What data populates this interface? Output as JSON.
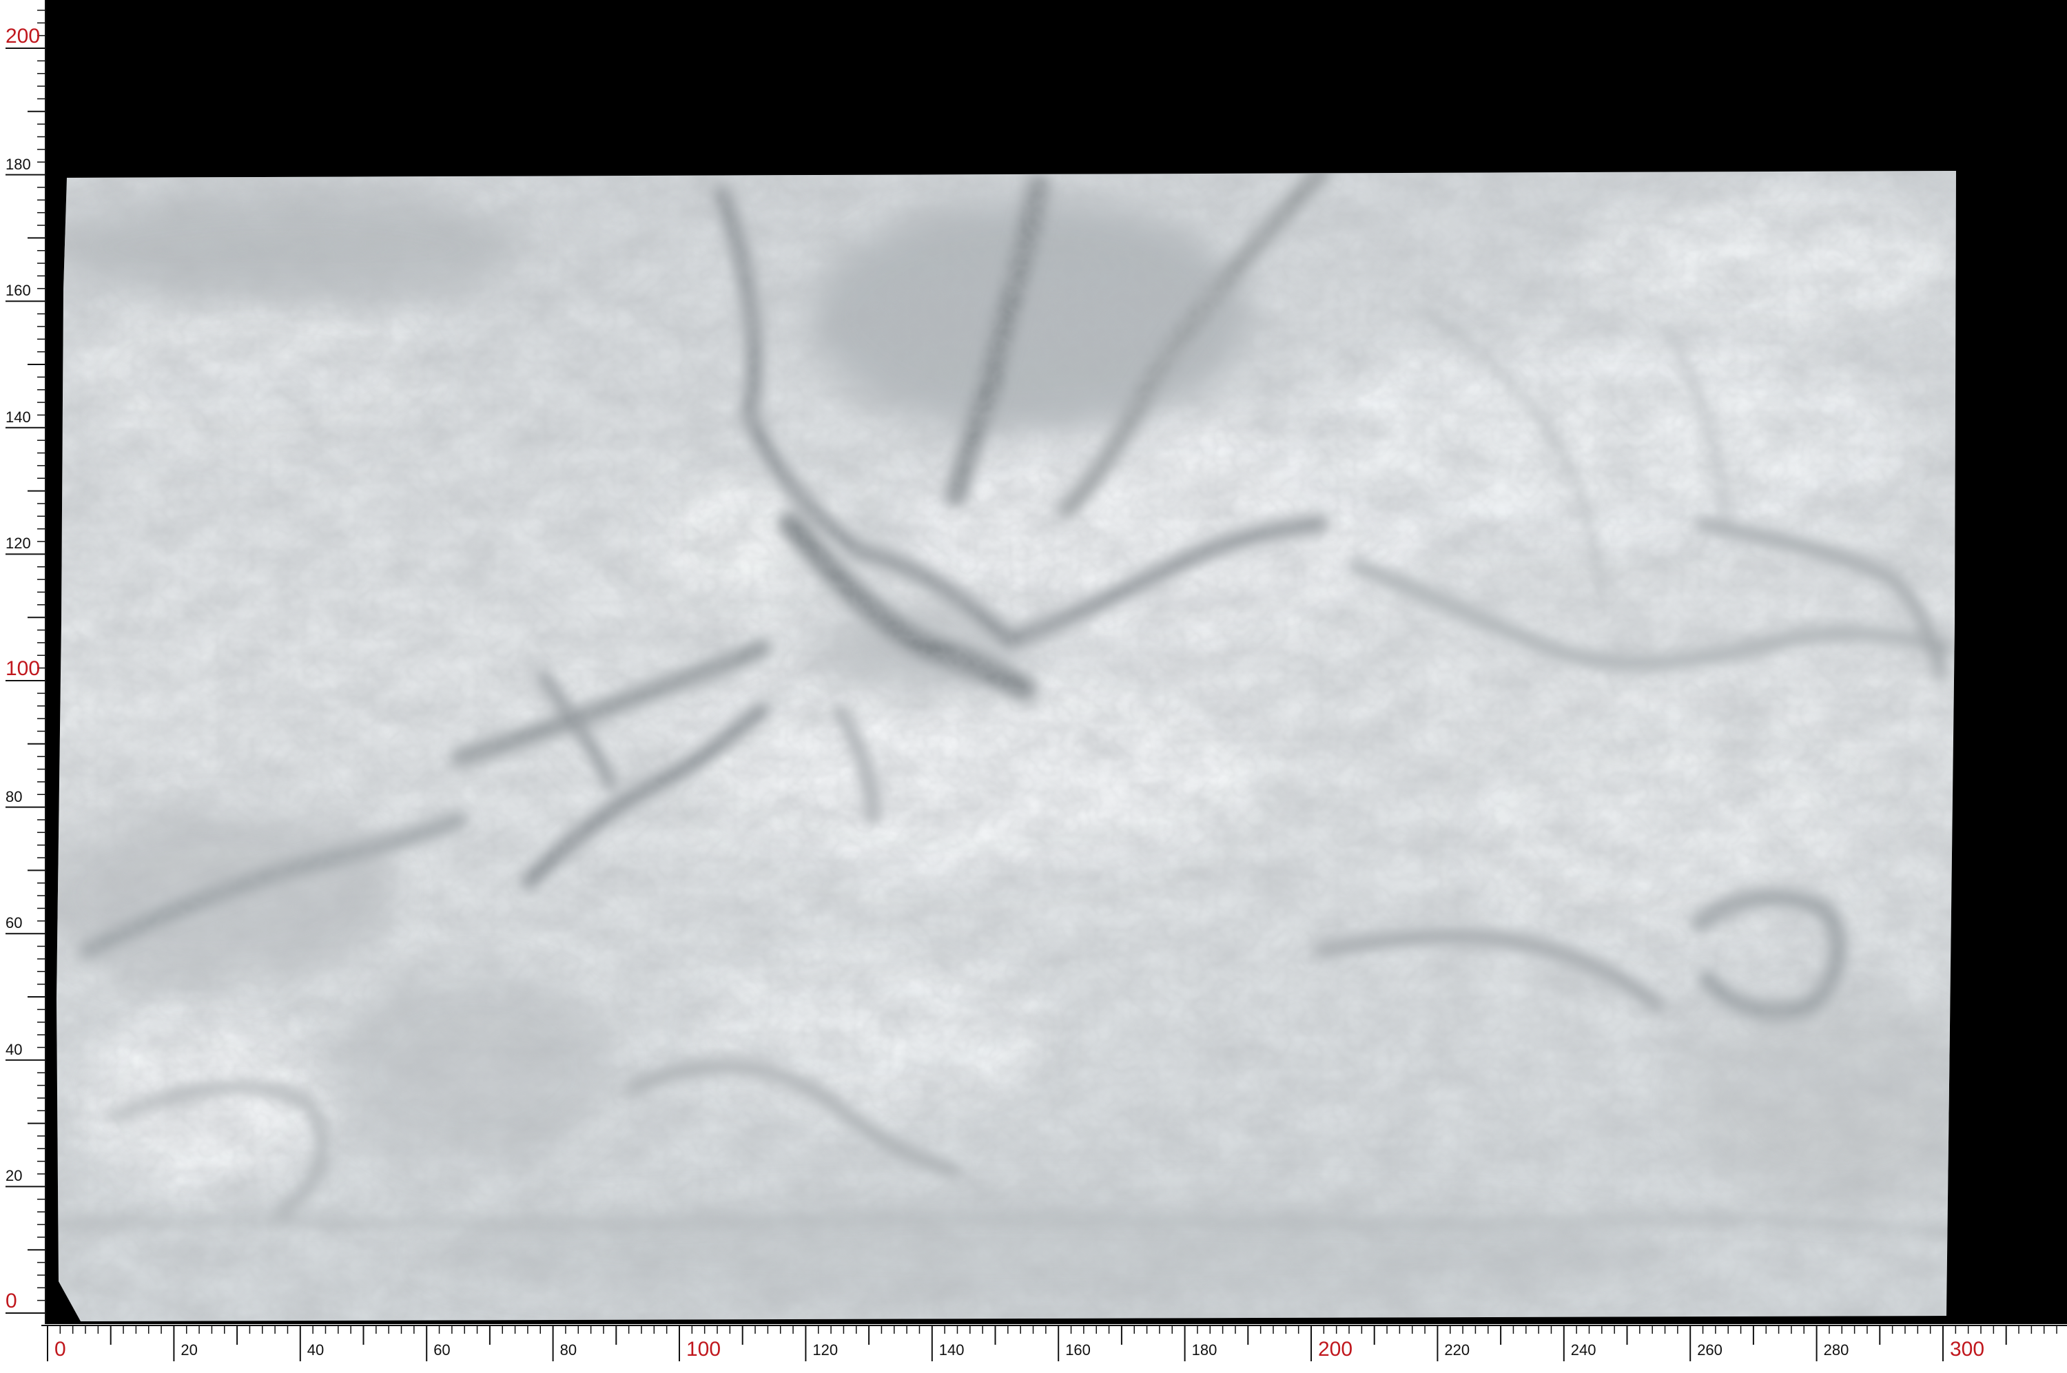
{
  "image": {
    "subject": "polished marble slab photograph with measurement rulers",
    "colors": {
      "background": "#000000",
      "slab_base": "#d9dde0",
      "slab_light": "#eef1f3",
      "vein_dark": "#7e8489",
      "vein_mid": "#a7acaf",
      "ruler_bg": "#ffffff",
      "ruler_line": "#111111",
      "major_label": "#c0171d"
    }
  },
  "rulers": {
    "horizontal": {
      "labels": [
        {
          "value": 0,
          "text": "0",
          "major": true
        },
        {
          "value": 20,
          "text": "20",
          "major": false
        },
        {
          "value": 40,
          "text": "40",
          "major": false
        },
        {
          "value": 60,
          "text": "60",
          "major": false
        },
        {
          "value": 80,
          "text": "80",
          "major": false
        },
        {
          "value": 100,
          "text": "100",
          "major": true
        },
        {
          "value": 120,
          "text": "120",
          "major": false
        },
        {
          "value": 140,
          "text": "140",
          "major": false
        },
        {
          "value": 160,
          "text": "160",
          "major": false
        },
        {
          "value": 180,
          "text": "180",
          "major": false
        },
        {
          "value": 200,
          "text": "200",
          "major": true
        },
        {
          "value": 220,
          "text": "220",
          "major": false
        },
        {
          "value": 240,
          "text": "240",
          "major": false
        },
        {
          "value": 260,
          "text": "260",
          "major": false
        },
        {
          "value": 280,
          "text": "280",
          "major": false
        },
        {
          "value": 300,
          "text": "300",
          "major": true
        }
      ]
    },
    "vertical": {
      "labels": [
        {
          "value": 0,
          "text": "0",
          "major": true
        },
        {
          "value": 20,
          "text": "20",
          "major": false
        },
        {
          "value": 40,
          "text": "40",
          "major": false
        },
        {
          "value": 60,
          "text": "60",
          "major": false
        },
        {
          "value": 80,
          "text": "80",
          "major": false
        },
        {
          "value": 100,
          "text": "100",
          "major": true
        },
        {
          "value": 120,
          "text": "120",
          "major": false
        },
        {
          "value": 140,
          "text": "140",
          "major": false
        },
        {
          "value": 160,
          "text": "160",
          "major": false
        },
        {
          "value": 180,
          "text": "180",
          "major": false
        },
        {
          "value": 200,
          "text": "200",
          "major": true
        }
      ]
    }
  }
}
